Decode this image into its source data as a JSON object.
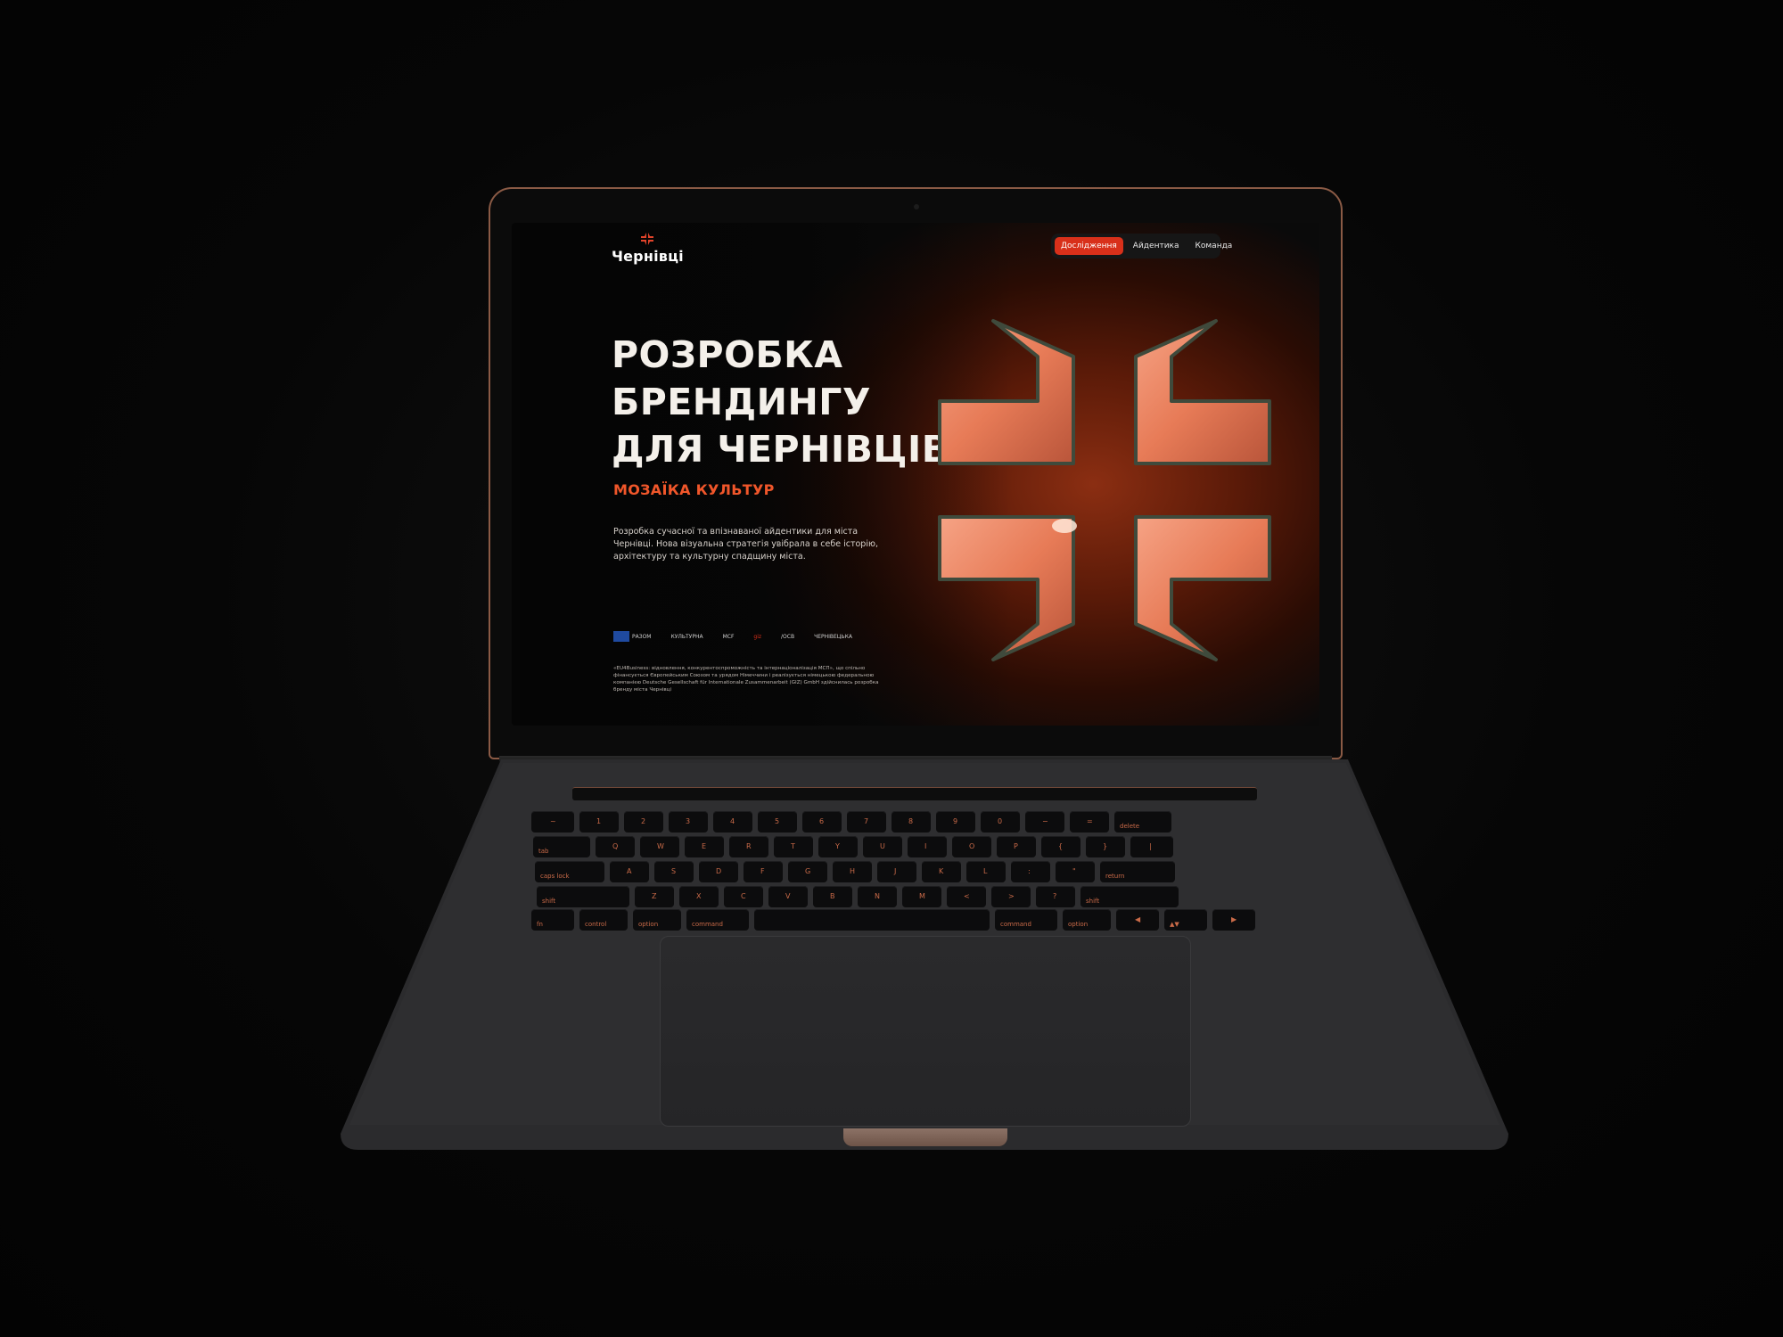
{
  "logo": {
    "text": "Чернівці",
    "icon": "cross-emblem-icon"
  },
  "nav": {
    "tabs": [
      {
        "label": "Дослідження",
        "active": true
      },
      {
        "label": "Айдентика",
        "active": false
      },
      {
        "label": "Команда",
        "active": false
      }
    ]
  },
  "hero": {
    "title_lines": [
      "РОЗРОБКА",
      "БРЕНДИНГУ",
      "ДЛЯ ЧЕРНІВЦІВ"
    ],
    "subtitle": "МОЗАЇКА КУЛЬТУР",
    "description": "Розробка сучасної та впізнаваної айдентики для міста Чернівці. Нова візуальна стратегія увібрала в себе історію, архітектуру та культурну спадщину міста."
  },
  "partners": [
    "РАЗОМ",
    "КУЛЬТУРНА",
    "MCF",
    "giz",
    "/OCB",
    "ЧЕРНІВЕЦЬКА"
  ],
  "footnote": "«EU4Business: відновлення, конкурентоспроможність та інтернаціоналізація МСП», що спільно фінансується Європейським Союзом та урядом Німеччини і реалізується німецькою федеральною компанією Deutsche Gesellschaft für Internationale Zusammenarbeit (GIZ) GmbH здійснилась розробка бренду міста Чернівці",
  "colors": {
    "accent": "#d8301a",
    "subtitle": "#f0562a",
    "emblem": "#f08a68",
    "bezel": "#8a5a45"
  },
  "keyboard": {
    "rows": [
      [
        "~",
        "1",
        "2",
        "3",
        "4",
        "5",
        "6",
        "7",
        "8",
        "9",
        "0",
        "−",
        "=",
        "delete"
      ],
      [
        "tab",
        "Q",
        "W",
        "E",
        "R",
        "T",
        "Y",
        "U",
        "I",
        "O",
        "P",
        "{",
        "}",
        "|"
      ],
      [
        "caps lock",
        "A",
        "S",
        "D",
        "F",
        "G",
        "H",
        "J",
        "K",
        "L",
        ":",
        "\"",
        "return"
      ],
      [
        "shift",
        "Z",
        "X",
        "C",
        "V",
        "B",
        "N",
        "M",
        "<",
        ">",
        "?",
        "shift"
      ],
      [
        "fn",
        "control",
        "option",
        "command",
        "",
        "command",
        "option",
        "◀",
        "▲▼",
        "▶"
      ]
    ]
  }
}
